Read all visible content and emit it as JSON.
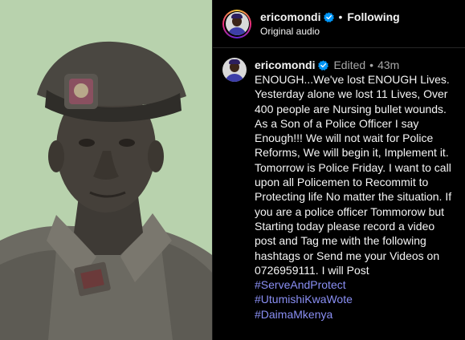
{
  "colors": {
    "background": "#000000",
    "text": "#f5f5f5",
    "muted": "#a8a8a8",
    "hashtag": "#8a8ff4",
    "verified": "#0095f6",
    "photo_bg": "#b6d0ac"
  },
  "header": {
    "username": "ericomondi",
    "separator": "•",
    "follow_status": "Following",
    "audio_label": "Original audio"
  },
  "caption": {
    "username": "ericomondi",
    "edited": "Edited",
    "separator": "•",
    "time": "43m",
    "text": "ENOUGH...We've lost ENOUGH Lives. Yesterday alone we lost 11 Lives, Over 400 people are Nursing bullet wounds. As a Son of a Police Officer I say Enough!!! We will not wait for Police Reforms, We will begin it, Implement it. Tomorrow is Police Friday. I want to call upon all Policemen to Recommit to Protecting life No matter the situation. If you are a police officer Tommorow but Starting today please record a video post and Tag me with the following hashtags or Send me your Videos on 0726959111. I will Post",
    "hashtags": [
      "#ServeAndProtect",
      "#UtumishiKwaWote",
      "#DaimaMkenya"
    ]
  },
  "icons": {
    "verified": "verified-badge-icon",
    "avatar": "profile-avatar"
  }
}
